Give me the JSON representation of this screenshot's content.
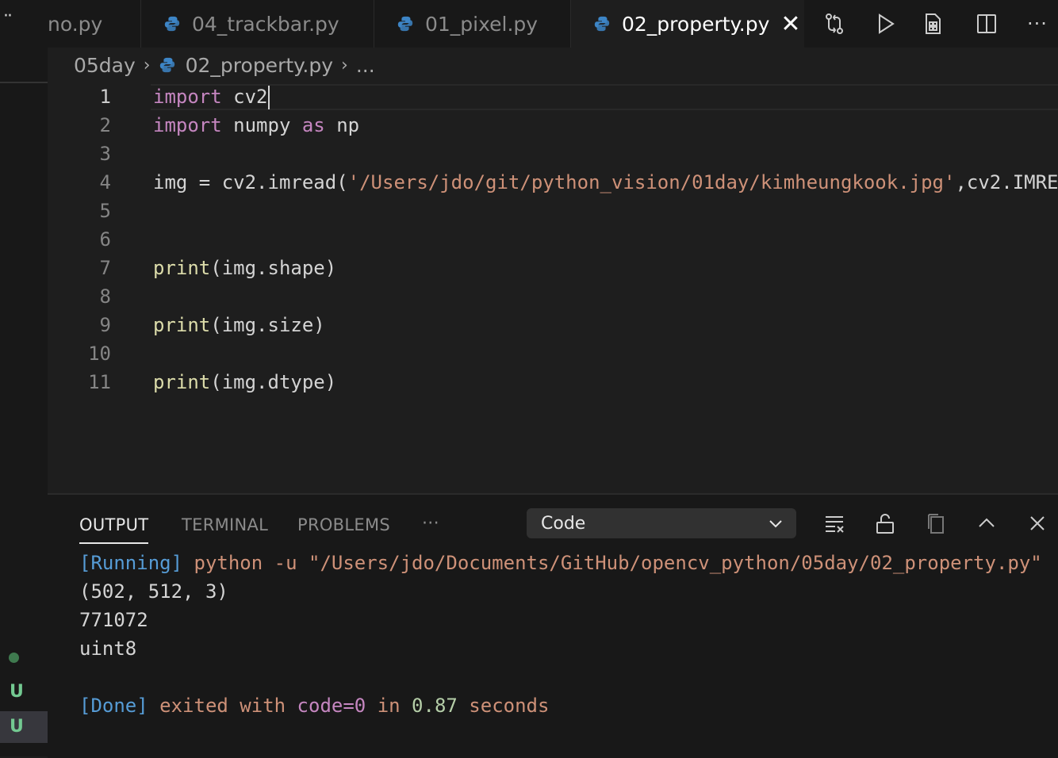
{
  "sidebar": {
    "menu_glyph": "··",
    "status_items": [
      "U",
      "U"
    ]
  },
  "tabs": [
    {
      "label": "no.py",
      "active": false,
      "icon": "python-icon"
    },
    {
      "label": "04_trackbar.py",
      "active": false,
      "icon": "python-icon"
    },
    {
      "label": "01_pixel.py",
      "active": false,
      "icon": "python-icon"
    },
    {
      "label": "02_property.py",
      "active": true,
      "icon": "python-icon",
      "close": "✕"
    }
  ],
  "toolbar": {
    "more": "···"
  },
  "breadcrumb": {
    "folder": "05day",
    "file": "02_property.py",
    "symbol": "..."
  },
  "editor": {
    "lines": [
      {
        "n": "1",
        "tokens": [
          [
            "kw",
            "import"
          ],
          [
            "",
            " cv2"
          ]
        ]
      },
      {
        "n": "2",
        "tokens": [
          [
            "kw",
            "import"
          ],
          [
            "",
            " numpy "
          ],
          [
            "kw",
            "as"
          ],
          [
            "",
            " np"
          ]
        ]
      },
      {
        "n": "3",
        "tokens": []
      },
      {
        "n": "4",
        "tokens": [
          [
            "",
            "img = cv2.imread("
          ],
          [
            "str",
            "'/Users/jdo/git/python_vision/01day/kimheungkook.jpg'"
          ],
          [
            "",
            ",cv2.IMRE"
          ]
        ]
      },
      {
        "n": "5",
        "tokens": []
      },
      {
        "n": "6",
        "tokens": []
      },
      {
        "n": "7",
        "tokens": [
          [
            "fn",
            "print"
          ],
          [
            "",
            "(img.shape)"
          ]
        ]
      },
      {
        "n": "8",
        "tokens": []
      },
      {
        "n": "9",
        "tokens": [
          [
            "fn",
            "print"
          ],
          [
            "",
            "(img.size)"
          ]
        ]
      },
      {
        "n": "10",
        "tokens": []
      },
      {
        "n": "11",
        "tokens": [
          [
            "fn",
            "print"
          ],
          [
            "",
            "(img.dtype)"
          ]
        ]
      }
    ]
  },
  "panel": {
    "tabs": [
      "OUTPUT",
      "TERMINAL",
      "PROBLEMS",
      "···"
    ],
    "active_tab": "OUTPUT",
    "channel": "Code",
    "output": {
      "running_tag": "[Running]",
      "running_cmd": " python -u \"/Users/jdo/Documents/GitHub/opencv_python/05day/02_property.py\"",
      "line1": "(502, 512, 3)",
      "line2": "771072",
      "line3": "uint8",
      "done_tag": "[Done]",
      "done_text1": " exited with ",
      "done_code": "code=0",
      "done_text2": " in ",
      "done_time": "0.87",
      "done_text3": " seconds"
    }
  },
  "colors": {
    "keyword": "#c586c0",
    "function": "#dcdcaa",
    "string": "#ce9178",
    "accent_blue": "#569cd6",
    "git_untracked": "#73c991"
  }
}
